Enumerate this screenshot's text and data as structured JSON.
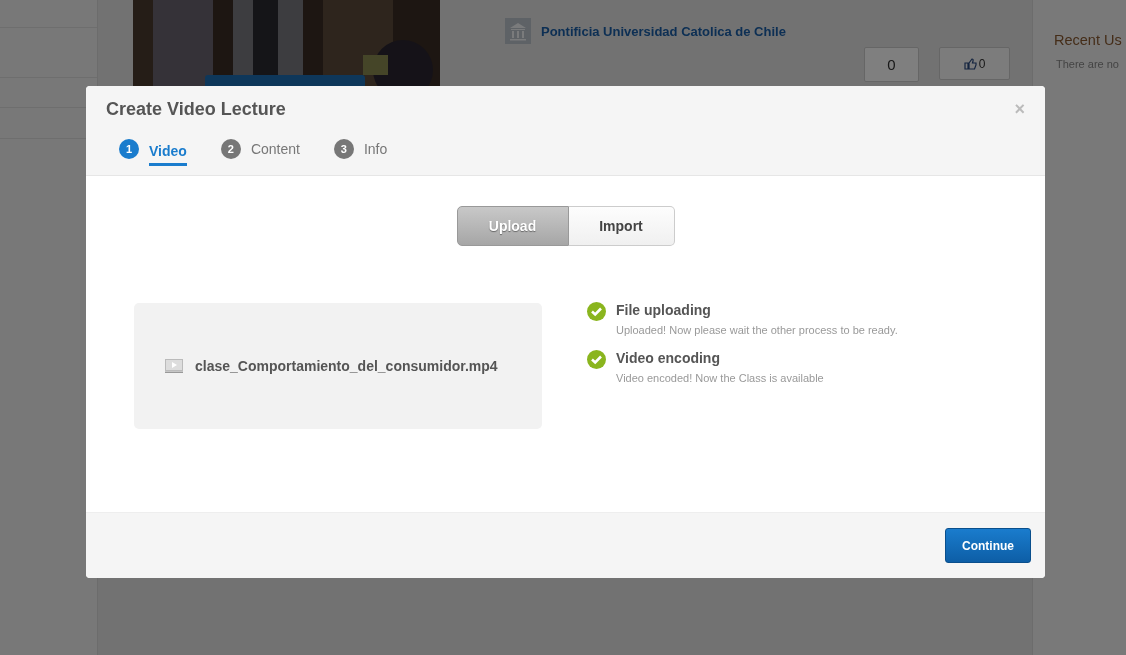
{
  "page": {
    "institution": "Pontificia Universidad Catolica de Chile",
    "view_count": "0",
    "like_count": "0",
    "recent_title": "Recent Us",
    "recent_text": "There are no"
  },
  "modal": {
    "title": "Create Video Lecture",
    "close": "×",
    "tabs": [
      {
        "number": "1",
        "label": "Video",
        "selected": true
      },
      {
        "number": "2",
        "label": "Content",
        "selected": false
      },
      {
        "number": "3",
        "label": "Info",
        "selected": false
      }
    ],
    "source_toggle": [
      {
        "label": "Upload",
        "selected": true
      },
      {
        "label": "Import",
        "selected": false
      }
    ],
    "file_name": "clase_Comportamiento_del_consumidor.mp4",
    "steps": [
      {
        "title": "File uploading",
        "description": "Uploaded! Now please wait the other process to be ready.",
        "done": true
      },
      {
        "title": "Video encoding",
        "description": "Video encoded! Now the Class is available",
        "done": true
      }
    ],
    "continue_button": "Continue"
  }
}
